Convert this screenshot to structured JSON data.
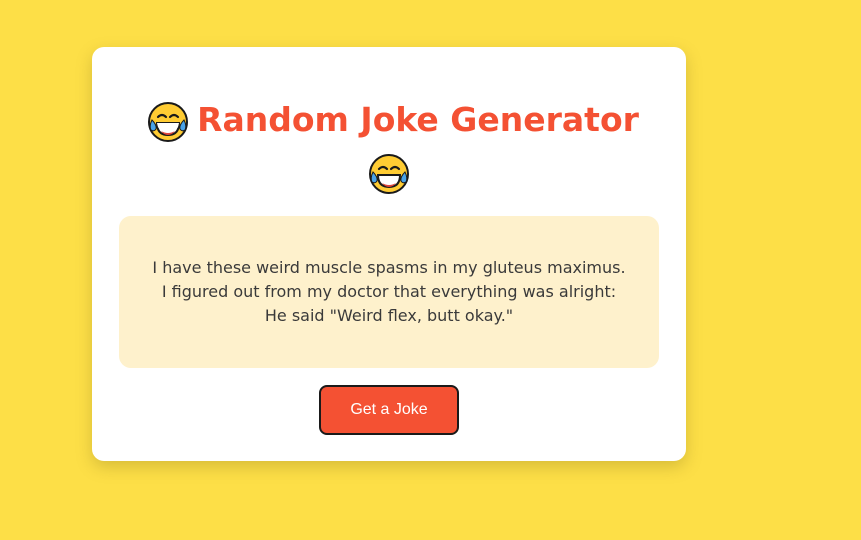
{
  "app": {
    "title_text": "Random Joke Generator",
    "title_icon": "face-with-tears-of-joy-icon"
  },
  "joke": {
    "text": "I have these weird muscle spasms in my gluteus maximus.\nI figured out from my doctor that everything was alright:\nHe said \"Weird flex, butt okay.\""
  },
  "actions": {
    "get_joke_label": "Get a Joke"
  },
  "colors": {
    "background": "#fddf47",
    "card": "#ffffff",
    "title": "#f45133",
    "joke_box": "#fef1cc",
    "button": "#f45133",
    "button_text": "#ffffff"
  }
}
